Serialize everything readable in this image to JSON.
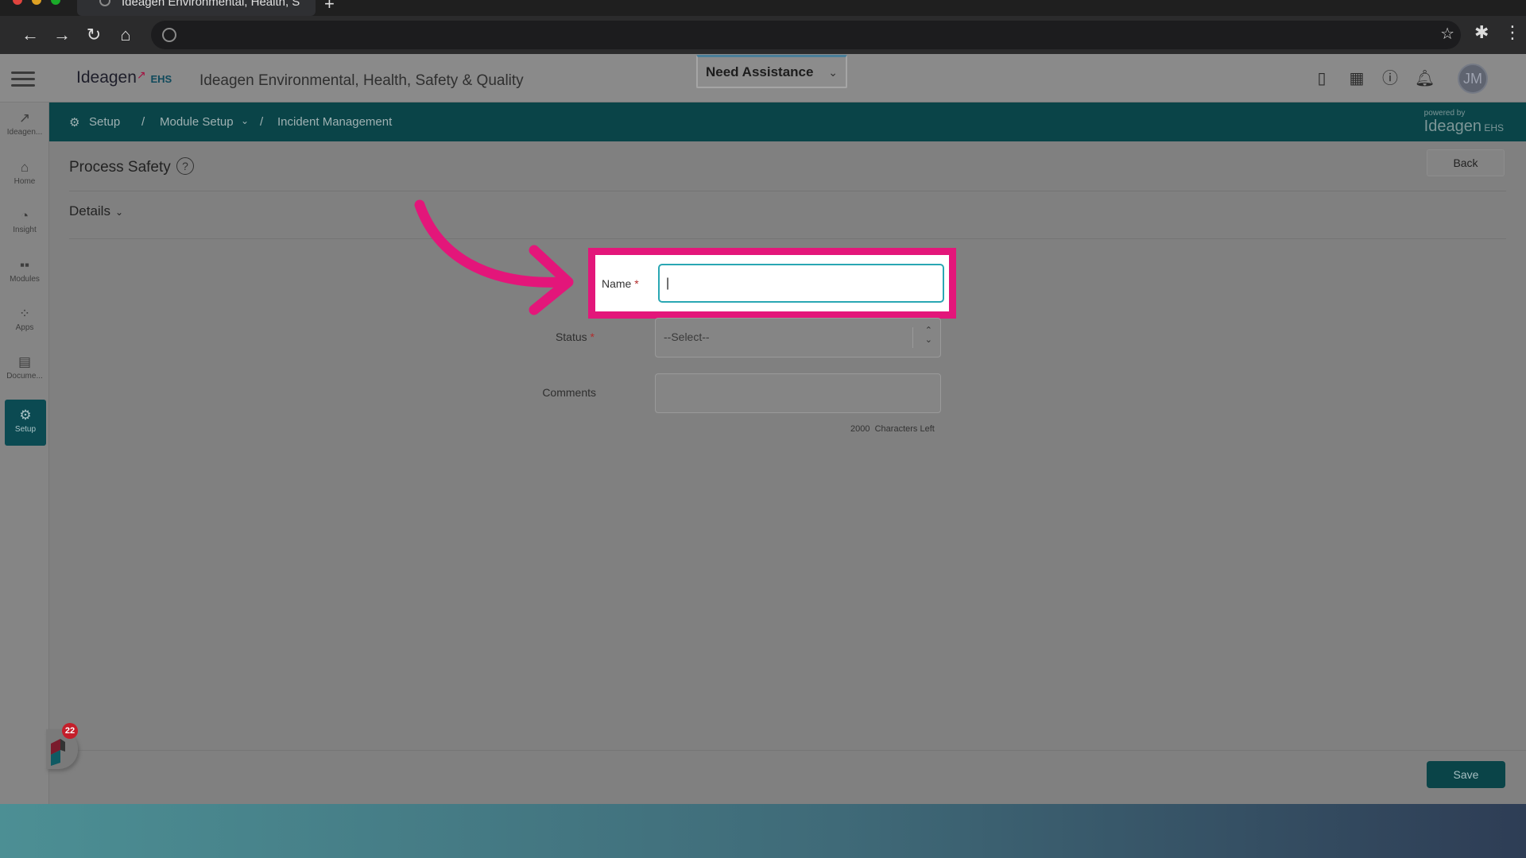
{
  "browser": {
    "tab_title": "Ideagen Environmental, Health, S",
    "new_tab": "+"
  },
  "header": {
    "logo_text": "Ideagen",
    "logo_suffix": "EHS",
    "app_title": "Ideagen Environmental, Health, Safety & Quality",
    "assist_label": "Need Assistance",
    "avatar_initials": "JM"
  },
  "rail": {
    "items": [
      {
        "label": "Ideagen..."
      },
      {
        "label": "Home"
      },
      {
        "label": "Insight"
      },
      {
        "label": "Modules"
      },
      {
        "label": "Apps"
      },
      {
        "label": "Docume..."
      },
      {
        "label": "Setup"
      }
    ]
  },
  "breadcrumb": {
    "setup": "Setup",
    "sep1": "/",
    "module_setup": "Module Setup",
    "sep2": "/",
    "incident": "Incident Management",
    "powered_by": "powered by",
    "powered_logo": "Ideagen",
    "powered_suffix": "EHS"
  },
  "page": {
    "title": "Process Safety",
    "help": "?",
    "back_label": "Back",
    "section": "Details"
  },
  "form": {
    "name_label": "Name",
    "name_value": "|",
    "status_label": "Status",
    "status_value": "--Select--",
    "comments_label": "Comments",
    "chars_count": "2000",
    "chars_text": "Characters Left",
    "required_mark": "*"
  },
  "footer": {
    "save_label": "Save",
    "notification_count": "22"
  },
  "colors": {
    "accent": "#0a4448",
    "highlight": "#e3167a",
    "focus": "#2aa7b3"
  }
}
